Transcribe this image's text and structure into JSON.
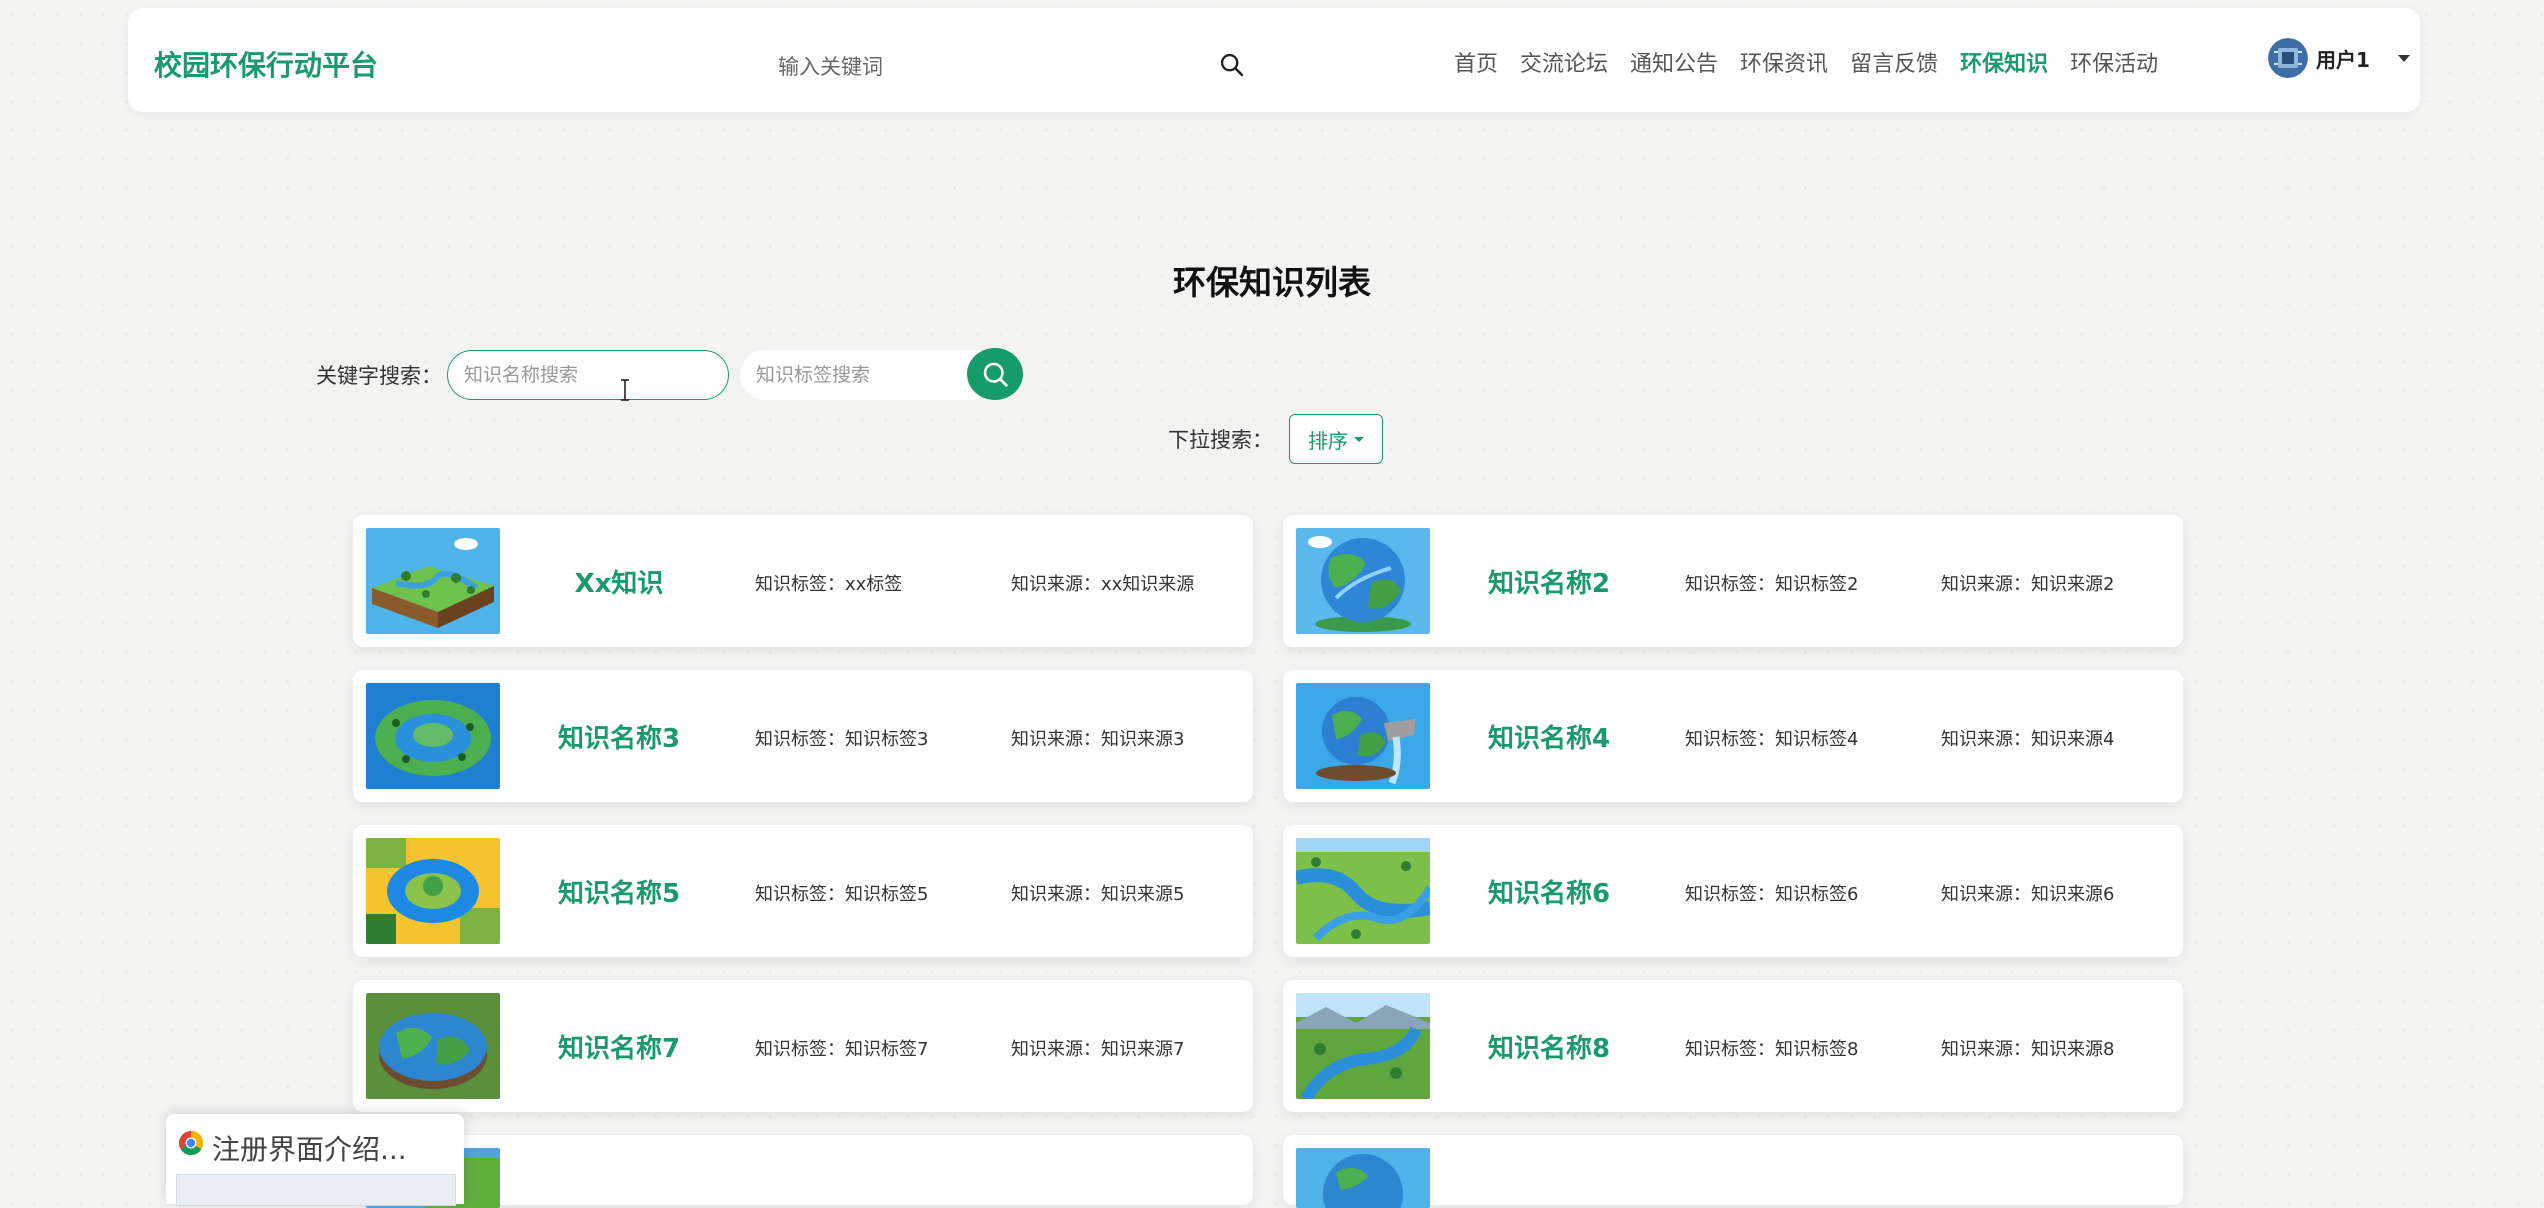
{
  "header": {
    "brand": "校园环保行动平台",
    "search_placeholder": "输入关键词",
    "nav": [
      "首页",
      "交流论坛",
      "通知公告",
      "环保资讯",
      "留言反馈",
      "环保知识",
      "环保活动"
    ],
    "active_nav": "环保知识",
    "user_name": "用户1"
  },
  "page": {
    "title": "环保知识列表",
    "keyword_label": "关键字搜索：",
    "name_placeholder": "知识名称搜索",
    "tag_placeholder": "知识标签搜索",
    "dropdown_label": "下拉搜索：",
    "sort_label": "排序"
  },
  "cards": [
    {
      "name": "Xx知识",
      "tag": "知识标签：xx标签",
      "source": "知识来源：xx知识来源"
    },
    {
      "name": "知识名称2",
      "tag": "知识标签：知识标签2",
      "source": "知识来源：知识来源2"
    },
    {
      "name": "知识名称3",
      "tag": "知识标签：知识标签3",
      "source": "知识来源：知识来源3"
    },
    {
      "name": "知识名称4",
      "tag": "知识标签：知识标签4",
      "source": "知识来源：知识来源4"
    },
    {
      "name": "知识名称5",
      "tag": "知识标签：知识标签5",
      "source": "知识来源：知识来源5"
    },
    {
      "name": "知识名称6",
      "tag": "知识标签：知识标签6",
      "source": "知识来源：知识来源6"
    },
    {
      "name": "知识名称7",
      "tag": "知识标签：知识标签7",
      "source": "知识来源：知识来源7"
    },
    {
      "name": "知识名称8",
      "tag": "知识标签：知识标签8",
      "source": "知识来源：知识来源8"
    }
  ],
  "popup": {
    "title": "注册界面介绍..."
  },
  "colors": {
    "accent": "#1a9a6c",
    "button": "#169b6a",
    "background": "#f3f3f2"
  }
}
